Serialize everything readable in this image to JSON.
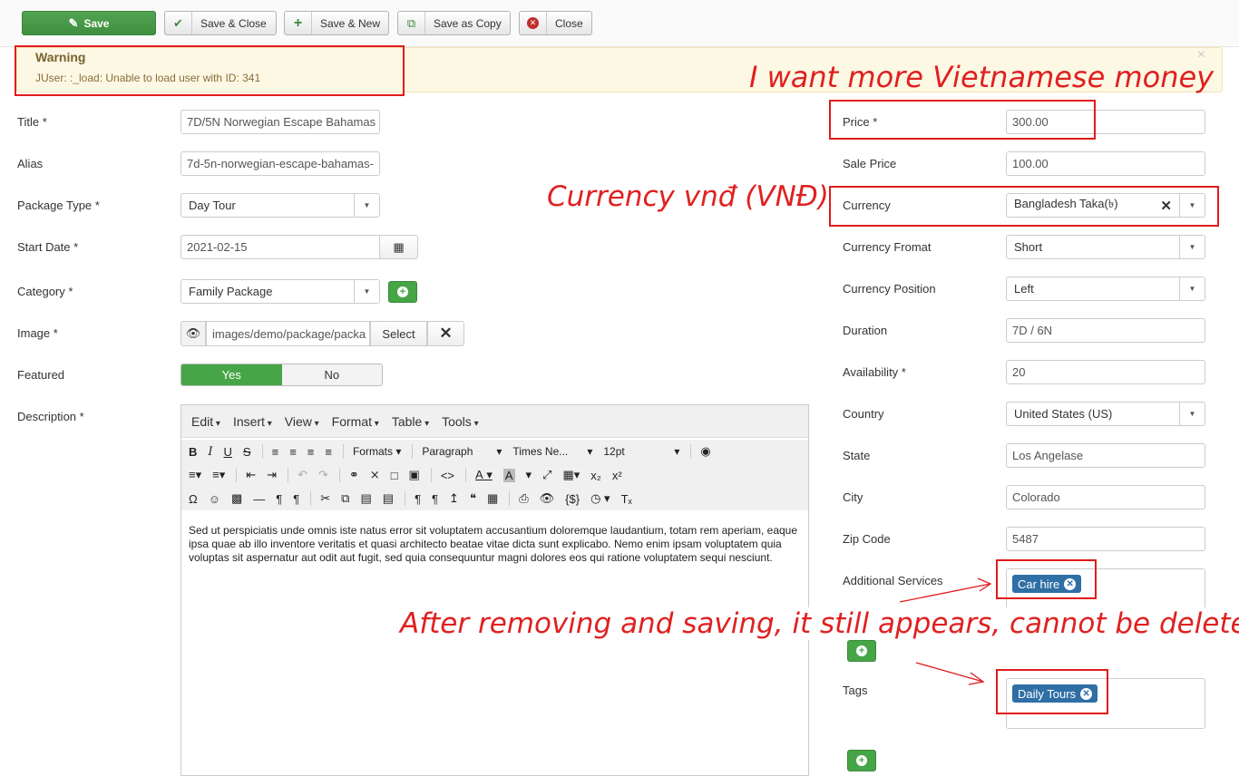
{
  "toolbar": {
    "save": "Save",
    "save_close": "Save & Close",
    "save_new": "Save & New",
    "save_copy": "Save as Copy",
    "close": "Close"
  },
  "warning": {
    "title": "Warning",
    "message": "JUser: :_load: Unable to load user with ID: 341",
    "close": "×"
  },
  "left_form": {
    "title_label": "Title *",
    "title_value": "7D/5N Norwegian Escape Bahamas",
    "alias_label": "Alias",
    "alias_value": "7d-5n-norwegian-escape-bahamas-",
    "package_type_label": "Package Type *",
    "package_type_value": "Day Tour",
    "start_date_label": "Start Date *",
    "start_date_value": "2021-02-15",
    "category_label": "Category *",
    "category_value": "Family Package",
    "image_label": "Image *",
    "image_value": "images/demo/package/packa",
    "image_select": "Select",
    "featured_label": "Featured",
    "featured_yes": "Yes",
    "featured_no": "No",
    "description_label": "Description *"
  },
  "editor": {
    "menus": [
      "Edit",
      "Insert",
      "View",
      "Format",
      "Table",
      "Tools"
    ],
    "formats": "Formats",
    "paragraph": "Paragraph",
    "font": "Times Ne...",
    "size": "12pt",
    "content": "Sed ut perspiciatis unde omnis iste natus error sit voluptatem accusantium doloremque laudantium, totam rem aperiam, eaque ipsa quae ab illo inventore veritatis et quasi architecto beatae vitae dicta sunt explicabo. Nemo enim ipsam voluptatem quia voluptas sit aspernatur aut odit aut fugit, sed quia consequuntur magni dolores eos qui ratione voluptatem sequi nesciunt."
  },
  "right_form": {
    "price_label": "Price *",
    "price_value": "300.00",
    "sale_price_label": "Sale Price",
    "sale_price_value": "100.00",
    "currency_label": "Currency",
    "currency_value": "Bangladesh Taka(৳)",
    "currency_format_label": "Currency Fromat",
    "currency_format_value": "Short",
    "currency_position_label": "Currency Position",
    "currency_position_value": "Left",
    "duration_label": "Duration",
    "duration_value": "7D / 6N",
    "availability_label": "Availability *",
    "availability_value": "20",
    "country_label": "Country",
    "country_value": "United States (US)",
    "state_label": "State",
    "state_value": "Los Angelase",
    "city_label": "City",
    "city_value": "Colorado",
    "zip_label": "Zip Code",
    "zip_value": "5487",
    "services_label": "Additional Services",
    "services_chip": "Car hire",
    "tags_label": "Tags",
    "tags_chip": "Daily Tours"
  },
  "annotations": {
    "vnd_money": "I want more Vietnamese money",
    "currency_vnd": "Currency vnđ (VNĐ)",
    "removing": "After removing and saving, it still appears, cannot be deleted"
  },
  "colors": {
    "accent_green": "#46a546",
    "chip_blue": "#2f6fa5",
    "annotation_red": "#e21b1b",
    "warning_bg": "#fcf8e3"
  }
}
